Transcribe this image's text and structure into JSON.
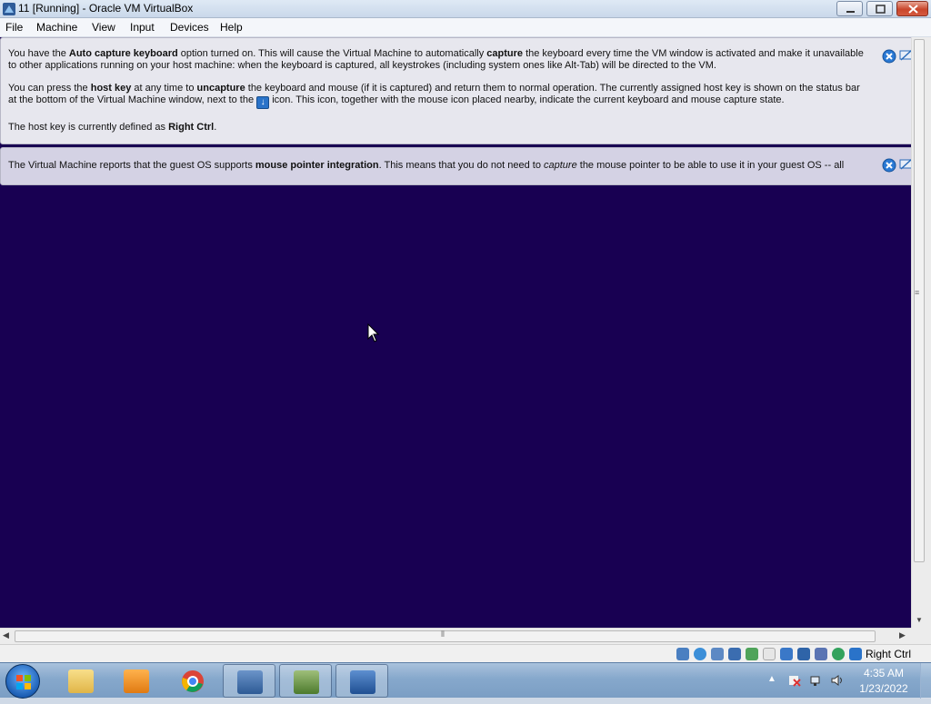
{
  "window": {
    "title": "11 [Running] - Oracle VM VirtualBox"
  },
  "menu": [
    "File",
    "Machine",
    "View",
    "Input",
    "Devices",
    "Help"
  ],
  "banners": {
    "keyboard": {
      "p1_a": "You have the ",
      "p1_b": "Auto capture keyboard",
      "p1_c": " option turned on. This will cause the Virtual Machine to automatically ",
      "p1_d": "capture",
      "p1_e": " the keyboard every time the VM window is activated and make it unavailable to other applications running on your host machine: when the keyboard is captured, all keystrokes (including system ones like Alt-Tab) will be directed to the VM.",
      "p2_a": "You can press the ",
      "p2_b": "host key",
      "p2_c": " at any time to ",
      "p2_d": "uncapture",
      "p2_e": " the keyboard and mouse (if it is captured) and return them to normal operation. The currently assigned host key is shown on the status bar at the bottom of the Virtual Machine window, next to the ",
      "p2_f": " icon. This icon, together with the mouse icon placed nearby, indicate the current keyboard and mouse capture state.",
      "p3_a": "The host key is currently defined as ",
      "p3_b": "Right Ctrl",
      "p3_c": "."
    },
    "mouse": {
      "a": "The Virtual Machine reports that the guest OS supports ",
      "b": "mouse pointer integration",
      "c": ". This means that you do not need to ",
      "d": "capture",
      "e": " the mouse pointer to be able to use it in your guest OS -- all"
    }
  },
  "statusbar": {
    "host_key": "Right Ctrl",
    "icons": [
      "hard-disk",
      "optical-drive",
      "audio",
      "network",
      "usb",
      "shared-folders",
      "display",
      "recording",
      "vt-x",
      "mouse-integration",
      "keyboard-capture"
    ]
  },
  "taskbar": {
    "apps": [
      "windows-explorer",
      "media-player",
      "chrome",
      "virtualbox",
      "task-manager",
      "vm-11"
    ],
    "clock_time": "4:35 AM",
    "clock_date": "1/23/2022"
  },
  "colors": {
    "vm_background": "#180052",
    "banner_bg": "#e7e7ee",
    "taskbar": "#86a8cc"
  }
}
